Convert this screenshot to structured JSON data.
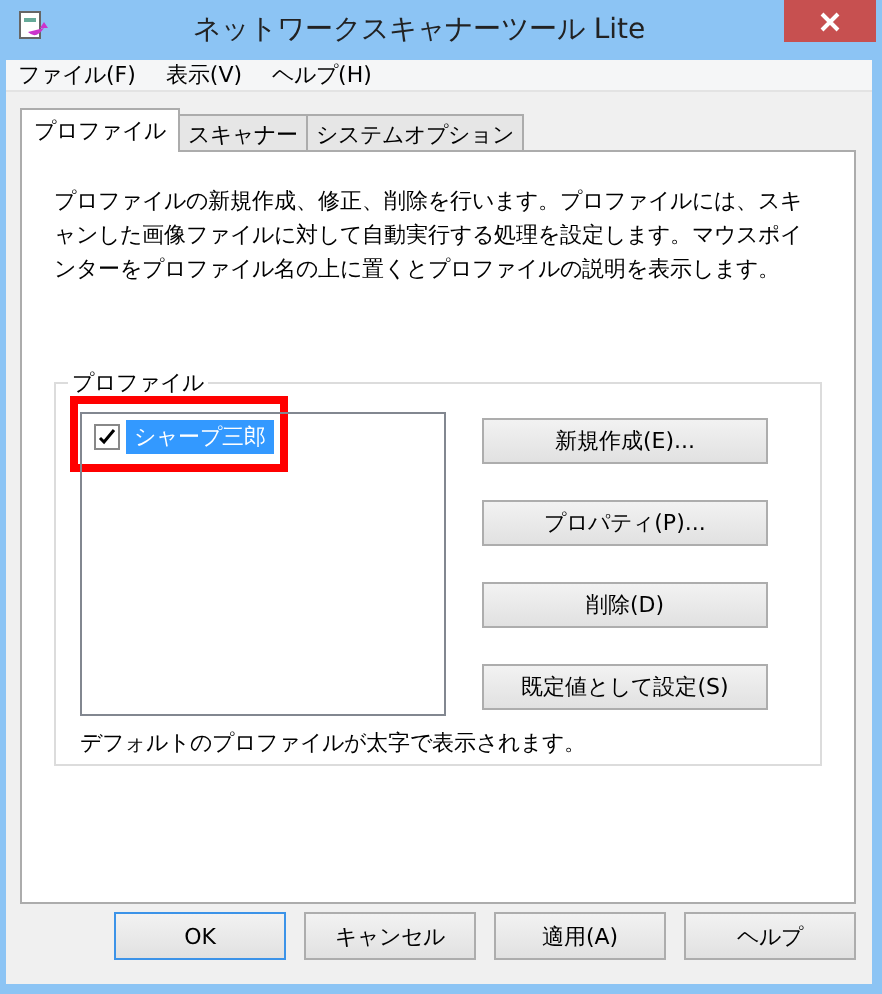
{
  "window": {
    "title": "ネットワークスキャナーツール Lite"
  },
  "menu": [
    "ファイル(F)",
    "表示(V)",
    "ヘルプ(H)"
  ],
  "tabs": [
    {
      "label": "プロファイル",
      "selected": true
    },
    {
      "label": "スキャナー",
      "selected": false
    },
    {
      "label": "システムオプション",
      "selected": false
    }
  ],
  "description": "プロファイルの新規作成、修正、削除を行います。プロファイルには、スキャンした画像ファイルに対して自動実行する処理を設定します。マウスポインターをプロファイル名の上に置くとプロファイルの説明を表示します。",
  "profiles": {
    "label": "プロファイル",
    "items": [
      {
        "name": "シャープ三郎",
        "checked": true,
        "selected": true,
        "highlighted": true
      }
    ],
    "buttons": [
      "新規作成(E)...",
      "プロパティ(P)...",
      "削除(D)",
      "既定値として設定(S)"
    ],
    "note": "デフォルトのプロファイルが太字で表示されます。"
  },
  "buttons": [
    {
      "label": "OK",
      "default": true
    },
    {
      "label": "キャンセル",
      "default": false
    },
    {
      "label": "適用(A)",
      "default": false
    },
    {
      "label": "ヘルプ",
      "default": false
    }
  ]
}
